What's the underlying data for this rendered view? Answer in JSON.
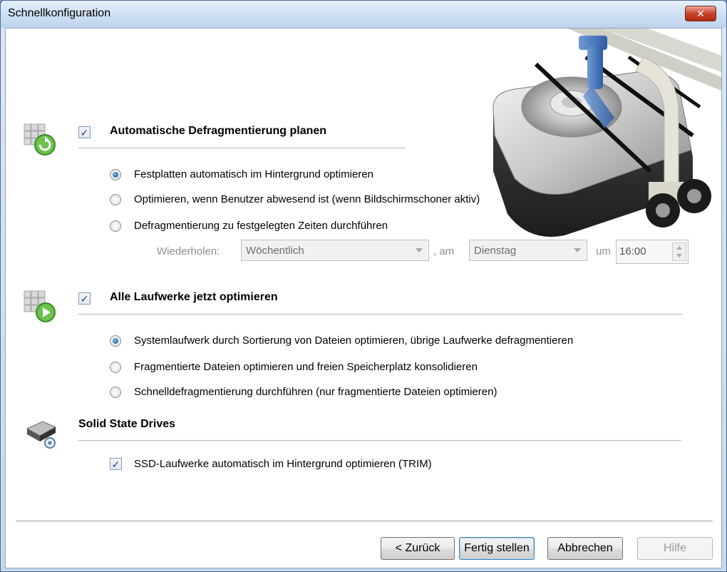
{
  "window": {
    "title": "Schnellkonfiguration",
    "close_label": "✕",
    "close_icon": "close-icon"
  },
  "section1": {
    "icon": "defrag-schedule-icon",
    "checked": true,
    "heading": "Automatische Defragmentierung planen",
    "options": [
      {
        "label": "Festplatten automatisch im Hintergrund optimieren",
        "selected": true
      },
      {
        "label": "Optimieren, wenn Benutzer abwesend ist (wenn Bildschirmschoner aktiv)",
        "selected": false
      },
      {
        "label": "Defragmentierung zu festgelegten Zeiten durchführen",
        "selected": false
      }
    ],
    "schedule": {
      "repeat_label": "Wiederholen:",
      "repeat_value": "Wöchentlich",
      "on_label": ", am",
      "day_value": "Dienstag",
      "at_label": "um",
      "time_value": "16:00"
    }
  },
  "section2": {
    "icon": "optimize-now-icon",
    "checked": true,
    "heading": "Alle Laufwerke jetzt optimieren",
    "options": [
      {
        "label": "Systemlaufwerk durch Sortierung von Dateien optimieren, übrige Laufwerke defragmentieren",
        "selected": true
      },
      {
        "label": "Fragmentierte Dateien optimieren und freien Speicherplatz konsolidieren",
        "selected": false
      },
      {
        "label": "Schnelldefragmentierung durchführen (nur fragmentierte Dateien optimieren)",
        "selected": false
      }
    ]
  },
  "section3": {
    "icon": "ssd-drive-icon",
    "heading": "Solid State Drives",
    "trim_checked": true,
    "trim_label": "SSD-Laufwerke automatisch im Hintergrund optimieren (TRIM)"
  },
  "buttons": {
    "back": "< Zurück",
    "finish": "Fertig stellen",
    "cancel": "Abbrechen",
    "help": "Hilfe"
  },
  "check_glyph": "✓"
}
